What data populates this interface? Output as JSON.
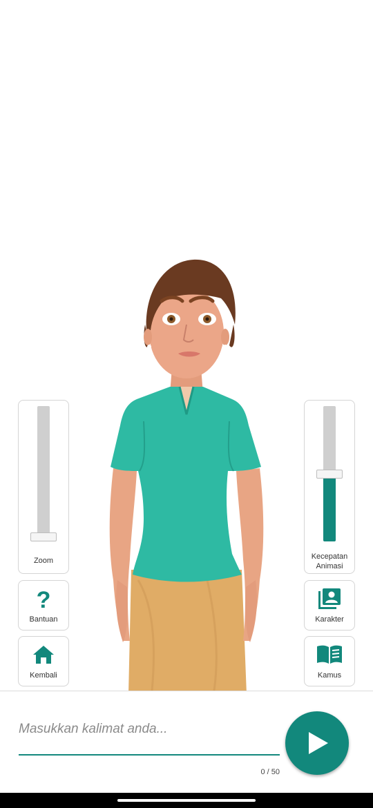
{
  "viewport": {
    "character": "avatar"
  },
  "zoom_slider": {
    "label": "Zoom",
    "value_fraction": 0.0
  },
  "speed_slider": {
    "label_line1": "Kecepatan",
    "label_line2": "Animasi",
    "value_fraction": 0.5
  },
  "buttons": {
    "help": {
      "label": "Bantuan",
      "icon": "help-icon"
    },
    "home": {
      "label": "Kembali",
      "icon": "home-icon"
    },
    "character": {
      "label": "Karakter",
      "icon": "character-icon"
    },
    "dictionary": {
      "label": "Kamus",
      "icon": "book-icon"
    }
  },
  "input": {
    "value": "",
    "placeholder": "Masukkan kalimat anda...",
    "counter": "0 / 50"
  },
  "play": {
    "icon": "play-icon"
  },
  "colors": {
    "accent": "#12887c",
    "shirt": "#2ebaa3",
    "skirt": "#e0ac66",
    "hair": "#6a3a21"
  }
}
